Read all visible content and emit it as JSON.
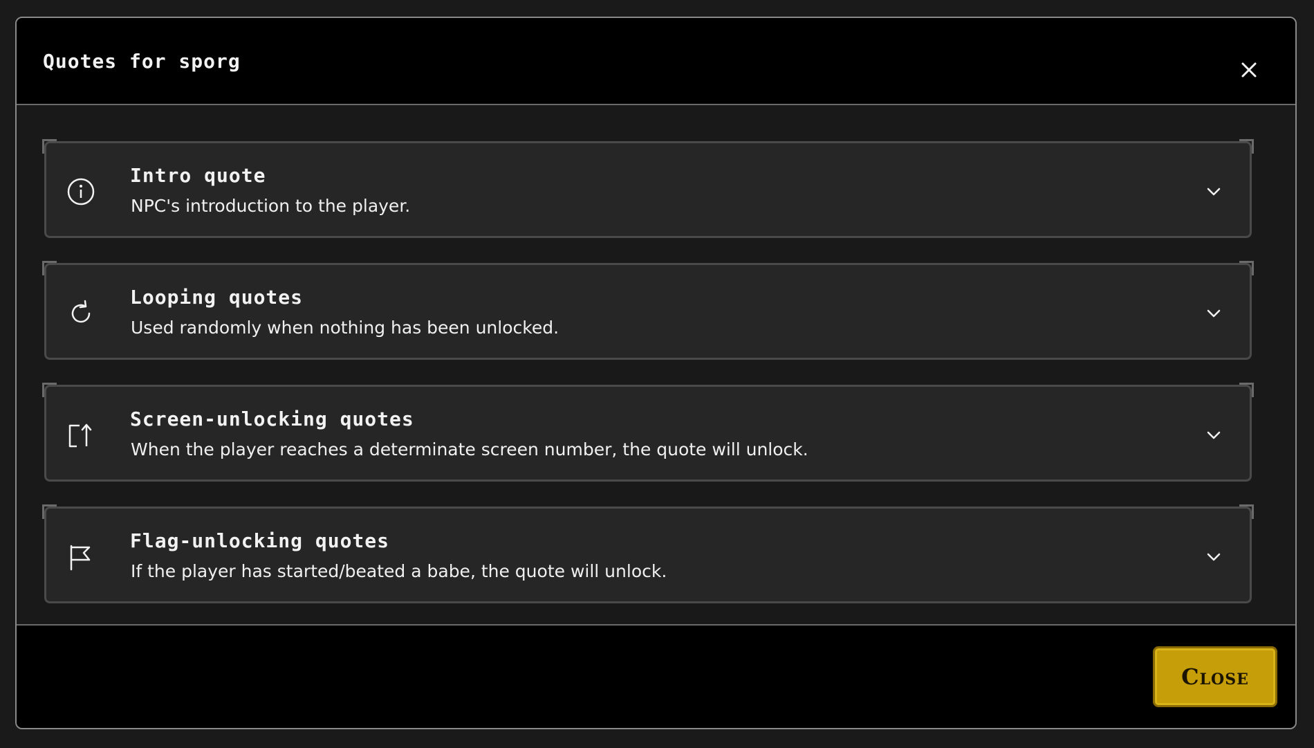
{
  "modal": {
    "title": "Quotes for sporg",
    "close_icon": "close-icon"
  },
  "quote_sections": [
    {
      "title": "Intro quote",
      "description": "NPC's introduction to the player.",
      "icon": "info-icon"
    },
    {
      "title": "Looping quotes",
      "description": "Used randomly when nothing has been unlocked.",
      "icon": "refresh-icon"
    },
    {
      "title": "Screen-unlocking quotes",
      "description": "When the player reaches a determinate screen number, the quote will unlock.",
      "icon": "screen-unlock-icon"
    },
    {
      "title": "Flag-unlocking quotes",
      "description": "If the player has started/beated a babe, the quote will unlock.",
      "icon": "flag-icon"
    }
  ],
  "footer": {
    "close_label": "Close"
  },
  "colors": {
    "accent": "#c69e0a",
    "header_bg": "#000000",
    "panel_bg": "#262626",
    "text": "#f2f2f2"
  }
}
